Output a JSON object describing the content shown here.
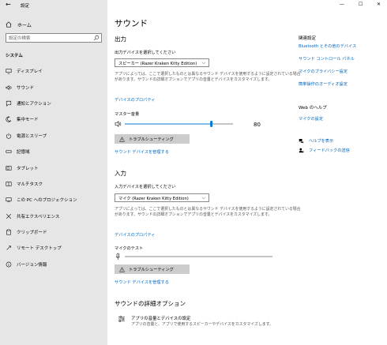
{
  "window": {
    "back_icon": "back-arrow-icon",
    "title": "設定",
    "minimize": "—",
    "maximize": "☐",
    "close": "✕"
  },
  "sidebar": {
    "home_label": "ホーム",
    "search_placeholder": "設定の検索",
    "section_label": "システム",
    "items": [
      {
        "label": "ディスプレイ",
        "icon": "display-icon"
      },
      {
        "label": "サウンド",
        "icon": "speaker-icon"
      },
      {
        "label": "通知とアクション",
        "icon": "notification-icon"
      },
      {
        "label": "集中モード",
        "icon": "moon-icon"
      },
      {
        "label": "電源とスリープ",
        "icon": "power-icon"
      },
      {
        "label": "記憶域",
        "icon": "storage-icon"
      },
      {
        "label": "タブレット",
        "icon": "tablet-icon"
      },
      {
        "label": "マルチタスク",
        "icon": "multitask-icon"
      },
      {
        "label": "この PC へのプロジェクション",
        "icon": "projection-icon"
      },
      {
        "label": "共有エクスペリエンス",
        "icon": "share-icon"
      },
      {
        "label": "クリップボード",
        "icon": "clipboard-icon"
      },
      {
        "label": "リモート デスクトップ",
        "icon": "remote-icon"
      },
      {
        "label": "バージョン情報",
        "icon": "info-icon"
      }
    ]
  },
  "main": {
    "title": "サウンド",
    "output": {
      "heading": "出力",
      "select_label": "出力デバイスを選択してください",
      "device": "スピーカー (Razer Kraken Kitty Edition)",
      "desc": "アプリによっては、ここで選択したものとは異なるサウンド デバイスを使用するように設定されている場合があります。サウンドの詳細オプションでアプリの音量とデバイスをカスタマイズします。",
      "properties_link": "デバイスのプロパティ",
      "master_volume_label": "マスター音量",
      "volume": 80,
      "volume_text": "80",
      "troubleshoot": "トラブルシューティング",
      "manage_link": "サウンド デバイスを管理する"
    },
    "input": {
      "heading": "入力",
      "select_label": "入力デバイスを選択してください",
      "device": "マイク (Razer Kraken Kitty Edition)",
      "desc": "アプリによっては、ここで選択したものとは異なるサウンド デバイスを使用するように設定されている場合があります。サウンドの詳細オプションでアプリの音量とデバイスをカスタマイズします。",
      "properties_link": "デバイスのプロパティ",
      "mic_test_label": "マイクのテスト",
      "troubleshoot": "トラブルシューティング",
      "manage_link": "サウンド デバイスを管理する"
    },
    "advanced": {
      "heading": "サウンドの詳細オプション",
      "title": "アプリの音量とデバイスの設定",
      "desc": "アプリの音量と、アプリで使用するスピーカーやデバイスをカスタマイズします。"
    }
  },
  "related": {
    "heading": "関連設定",
    "links": [
      "Bluetooth とその他のデバイス",
      "サウンド コントロール パネル",
      "マイクのプライバシー設定",
      "簡単操作のオーディオ設定"
    ],
    "web_help_heading": "Web のヘルプ",
    "web_help_link": "マイクの設定",
    "help_label": "ヘルプを表示",
    "feedback_label": "フィードバックの送信"
  },
  "colors": {
    "accent": "#0067c0",
    "sidebar_bg": "#e6e6e6",
    "slider": "#0078d4"
  }
}
